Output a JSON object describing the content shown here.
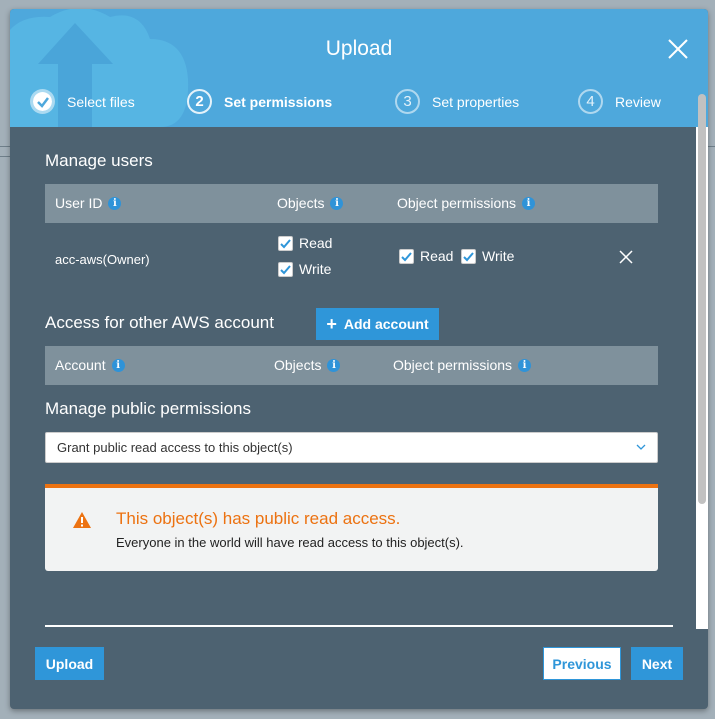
{
  "dialog": {
    "title": "Upload",
    "close_icon": "close-icon"
  },
  "steps": [
    {
      "number": "1",
      "label": "Select files",
      "state": "completed"
    },
    {
      "number": "2",
      "label": "Set permissions",
      "state": "active"
    },
    {
      "number": "3",
      "label": "Set properties",
      "state": "upcoming"
    },
    {
      "number": "4",
      "label": "Review",
      "state": "upcoming"
    }
  ],
  "manage_users": {
    "title": "Manage users",
    "columns": [
      "User ID",
      "Objects",
      "Object permissions"
    ],
    "rows": [
      {
        "user_id": "acc-aws(Owner)",
        "objects": [
          {
            "label": "Read",
            "checked": true
          },
          {
            "label": "Write",
            "checked": true
          }
        ],
        "object_permissions": [
          {
            "label": "Read",
            "checked": true
          },
          {
            "label": "Write",
            "checked": true
          }
        ]
      }
    ]
  },
  "other_accounts": {
    "title": "Access for other AWS account",
    "add_button": "Add account",
    "columns": [
      "Account",
      "Objects",
      "Object permissions"
    ]
  },
  "public_permissions": {
    "title": "Manage public permissions",
    "selected": "Grant public read access to this object(s)"
  },
  "alert": {
    "title": "This object(s) has public read access.",
    "body": "Everyone in the world will have read access to this object(s).",
    "color": "#ec7211"
  },
  "footer": {
    "upload": "Upload",
    "previous": "Previous",
    "next": "Next"
  },
  "colors": {
    "header": "#4ea8dc",
    "body": "#4d6271",
    "accent": "#2f96d9",
    "warning": "#ec7211"
  }
}
